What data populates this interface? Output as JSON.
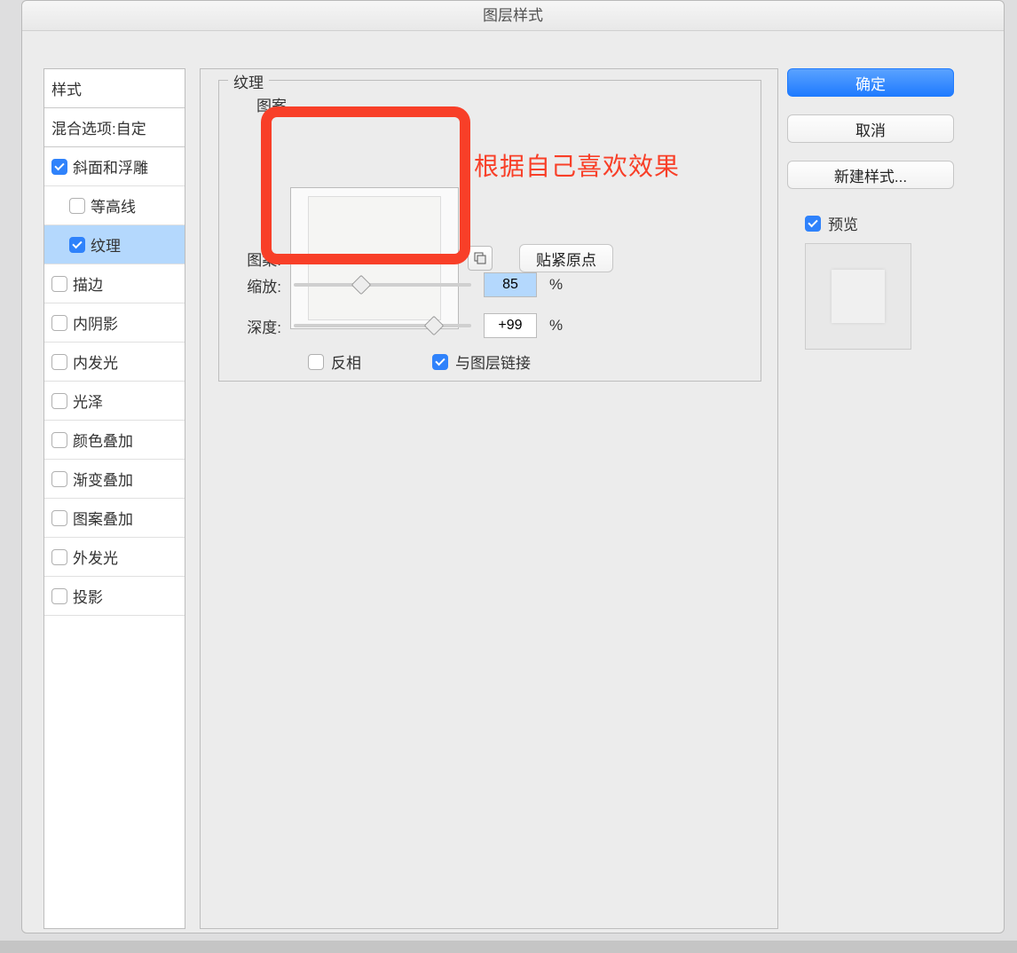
{
  "window": {
    "title": "图层样式"
  },
  "sidebar": {
    "styles_header": "样式",
    "blending_header": "混合选项:自定",
    "bevel": {
      "label": "斜面和浮雕",
      "checked": true
    },
    "contour": {
      "label": "等高线",
      "checked": false
    },
    "texture": {
      "label": "纹理",
      "checked": true
    },
    "stroke": {
      "label": "描边",
      "checked": false
    },
    "inner_shadow": {
      "label": "内阴影",
      "checked": false
    },
    "inner_glow": {
      "label": "内发光",
      "checked": false
    },
    "satin": {
      "label": "光泽",
      "checked": false
    },
    "color_overlay": {
      "label": "颜色叠加",
      "checked": false
    },
    "gradient_overlay": {
      "label": "渐变叠加",
      "checked": false
    },
    "pattern_overlay": {
      "label": "图案叠加",
      "checked": false
    },
    "outer_glow": {
      "label": "外发光",
      "checked": false
    },
    "drop_shadow": {
      "label": "投影",
      "checked": false
    }
  },
  "panel": {
    "group_title": "纹理",
    "subgroup_title": "图案",
    "pattern_label": "图案:",
    "snap_button": "贴紧原点",
    "scale_label": "缩放:",
    "scale_value": "85",
    "scale_unit": "%",
    "depth_label": "深度:",
    "depth_value": "+99",
    "depth_unit": "%",
    "invert_label": "反相",
    "invert_checked": false,
    "link_label": "与图层链接",
    "link_checked": true
  },
  "right": {
    "ok": "确定",
    "cancel": "取消",
    "new_style": "新建样式...",
    "preview_label": "预览",
    "preview_checked": true
  },
  "annotation": {
    "text": "根据自己喜欢效果"
  }
}
